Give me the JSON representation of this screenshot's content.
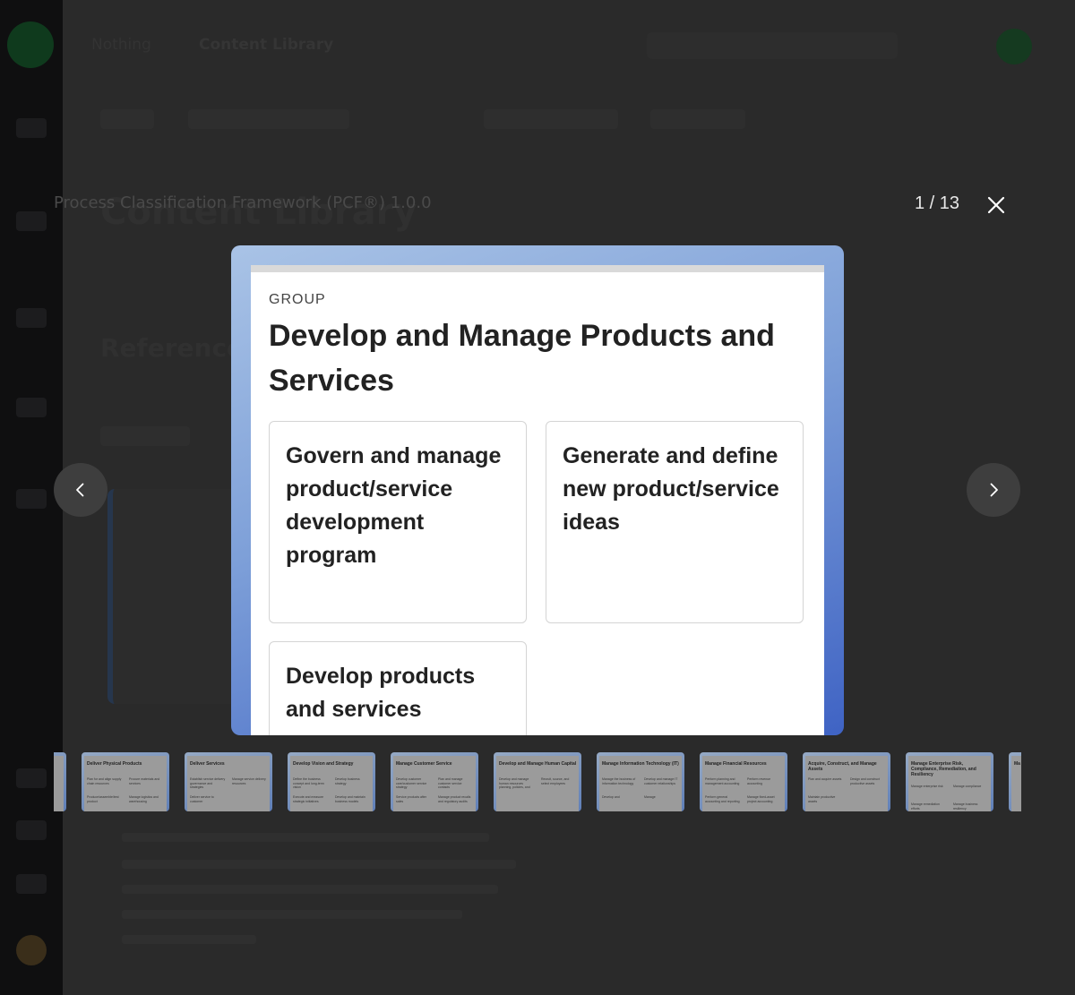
{
  "background": {
    "breadcrumb": "Nothing",
    "breadcrumb_current": "Content Library",
    "page_title": "Content Library",
    "section_heading": "Reference"
  },
  "lightbox": {
    "caption": "Process Classification Framework (PCF®) 1.0.0",
    "counter": "1 / 13",
    "slide": {
      "eyebrow": "GROUP",
      "title": "Develop and Manage Products and Services",
      "processes": [
        "Govern and manage product/service development program",
        "Generate and define new product/service ideas",
        "Develop products and services"
      ]
    },
    "thumbnails": [
      {
        "title": "",
        "boxes": []
      },
      {
        "title": "Deliver Physical Products",
        "boxes": [
          "Plan for and align supply chain resources",
          "Procure materials and services",
          "Produce/assemble/test product",
          "Manage logistics and warehousing"
        ]
      },
      {
        "title": "Deliver Services",
        "boxes": [
          "Establish service delivery governance and strategies",
          "Manage service delivery resources",
          "Deliver service to customer",
          ""
        ]
      },
      {
        "title": "Develop Vision and Strategy",
        "boxes": [
          "Define the business concept and long-term vision",
          "Develop business strategy",
          "Execute and measure strategic initiatives",
          "Develop and maintain business models"
        ]
      },
      {
        "title": "Manage Customer Service",
        "boxes": [
          "Develop customer care/customer service strategy",
          "Plan and manage customer service contacts",
          "Service products after sales",
          "Manage product recalls and regulatory audits"
        ]
      },
      {
        "title": "Develop and Manage Human Capital",
        "boxes": [
          "Develop and manage human resources planning, policies, and strategies",
          "Recruit, source, and select employees",
          "",
          ""
        ]
      },
      {
        "title": "Manage Information Technology (IT)",
        "boxes": [
          "Manage the business of information technology",
          "Develop and manage IT customer relationships",
          "Develop and",
          "Manage"
        ]
      },
      {
        "title": "Manage Financial Resources",
        "boxes": [
          "Perform planning and management accounting",
          "Perform revenue accounting",
          "Perform general accounting and reporting",
          "Manage fixed-asset project accounting"
        ]
      },
      {
        "title": "Acquire, Construct, and Manage Assets",
        "boxes": [
          "Plan and acquire assets",
          "Design and construct productive assets",
          "Maintain productive assets",
          ""
        ]
      },
      {
        "title": "Manage Enterprise Risk, Compliance, Remediation, and Resiliency",
        "boxes": [
          "Manage enterprise risk",
          "Manage compliance",
          "Manage remediation efforts",
          "Manage business resiliency"
        ]
      },
      {
        "title": "Ma",
        "boxes": [
          "",
          "",
          "",
          ""
        ]
      }
    ]
  }
}
